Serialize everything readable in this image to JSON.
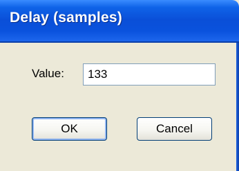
{
  "window": {
    "title": "Delay (samples)"
  },
  "form": {
    "value_label": "Value:",
    "value": "133"
  },
  "buttons": {
    "ok_label": "OK",
    "cancel_label": "Cancel"
  },
  "colors": {
    "titlebar_blue": "#0a52dd",
    "dialog_background": "#ece9d8",
    "button_border": "#003c74"
  }
}
